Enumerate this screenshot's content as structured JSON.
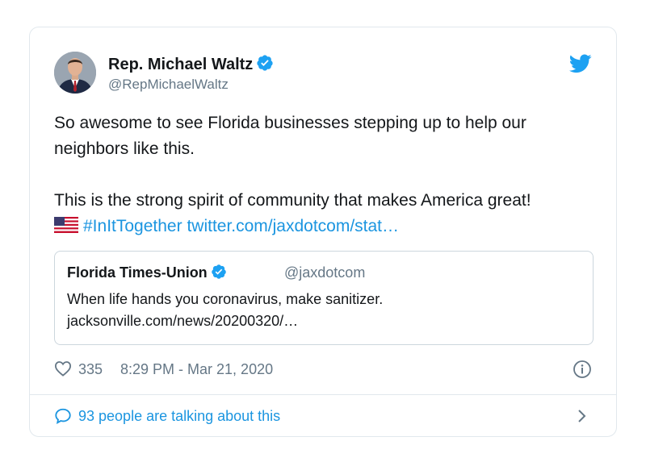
{
  "author": {
    "display_name": "Rep. Michael Waltz",
    "handle": "@RepMichaelWaltz"
  },
  "tweet": {
    "line1": "So awesome to see Florida businesses stepping up to help our neighbors like this.",
    "line2": "This is the strong spirit of community that makes America great!",
    "hashtag": "#InItTogether",
    "link": "twitter.com/jaxdotcom/stat…"
  },
  "quoted": {
    "name": "Florida Times-Union",
    "handle": "@jaxdotcom",
    "text": "When life hands you coronavirus, make sanitizer.",
    "url": "jacksonville.com/news/20200320/…"
  },
  "meta": {
    "likes": "335",
    "timestamp": "8:29 PM - Mar 21, 2020"
  },
  "footer": {
    "talking": "93 people are talking about this"
  },
  "colors": {
    "accent": "#1b95e0",
    "verified": "#1da1f2",
    "muted": "#657786",
    "border": "#e1e8ed"
  },
  "icons": [
    "avatar",
    "verified-badge-icon",
    "twitter-bird-icon",
    "us-flag-icon",
    "heart-icon",
    "info-icon",
    "speech-bubble-icon",
    "chevron-right-icon"
  ]
}
